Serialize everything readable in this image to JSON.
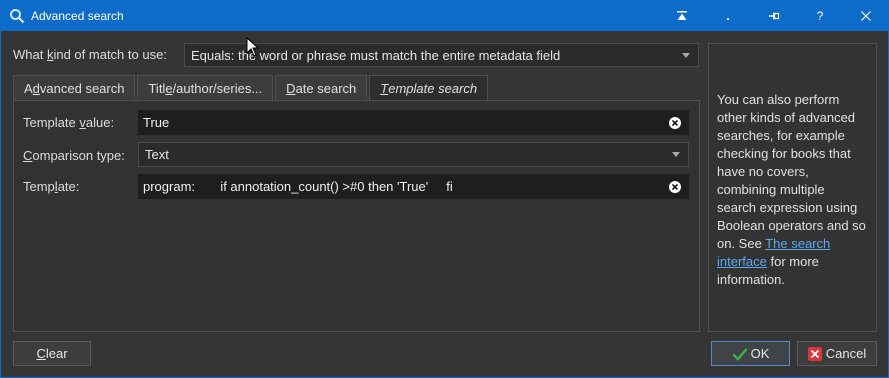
{
  "window": {
    "title": "Advanced search",
    "controls": [
      "▲",
      ".",
      "⊣",
      "?",
      "✕"
    ]
  },
  "match": {
    "label_pre": "What ",
    "label_ul": "k",
    "label_post": "ind of match to use:",
    "value": "Equals: the word or phrase must match the entire metadata field"
  },
  "tabs": [
    {
      "pre": "A",
      "ul": "d",
      "post": "vanced search"
    },
    {
      "pre": "Titl",
      "ul": "e",
      "post": "/author/series..."
    },
    {
      "pre": "",
      "ul": "D",
      "post": "ate search"
    },
    {
      "pre": "",
      "ul": "T",
      "post": "emplate search"
    }
  ],
  "template_tab": {
    "value_label_pre": "Template ",
    "value_label_ul": "v",
    "value_label_post": "alue:",
    "value": "True",
    "comparison_label_pre": "",
    "comparison_label_ul": "C",
    "comparison_label_post": "omparison type:",
    "comparison_value": "Text",
    "template_label_pre": "Temp",
    "template_label_ul": "l",
    "template_label_post": "ate:",
    "template_value": "program:       if annotation_count() >#0 then 'True'     fi"
  },
  "side": {
    "text": "You can also perform other kinds of advanced searches, for example checking for books that have no covers, combining multiple search expression using Boolean operators and so on. See ",
    "link": "The search interface",
    "text_after": " for more information."
  },
  "buttons": {
    "clear": "Clear",
    "ok": "OK",
    "cancel": "Cancel"
  },
  "colors": {
    "titlebar": "#0d6bc9",
    "link": "#5aa9f0",
    "ok_icon": "#3cb043",
    "cancel_icon": "#d9363e"
  }
}
